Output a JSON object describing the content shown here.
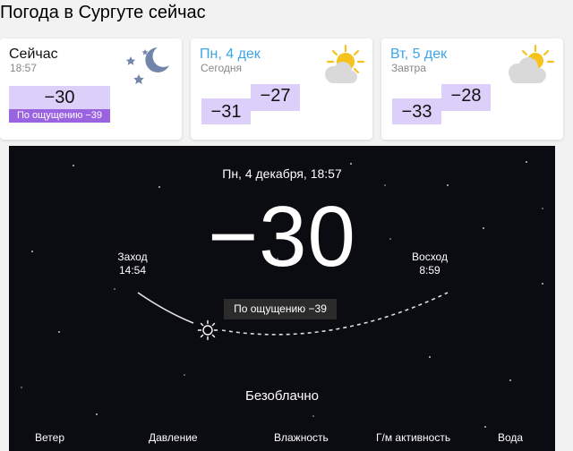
{
  "page_title": "Погода в Сургуте сейчас",
  "now_card": {
    "title": "Сейчас",
    "time": "18:57",
    "temp": "−30",
    "feels": "По ощущению −39",
    "icon": "moon-stars-icon"
  },
  "day_cards": [
    {
      "title": "Пн, 4 дек",
      "subtitle": "Сегодня",
      "min": "−31",
      "max": "−27",
      "icon": "sun-cloud-icon"
    },
    {
      "title": "Вт, 5 дек",
      "subtitle": "Завтра",
      "min": "−33",
      "max": "−28",
      "icon": "sun-cloud-icon"
    }
  ],
  "detail": {
    "date_time": "Пн, 4 декабря, 18:57",
    "temp": "−30",
    "feels": "По ощущению −39",
    "sunset_label": "Заход",
    "sunset_time": "14:54",
    "sunrise_label": "Восход",
    "sunrise_time": "8:59",
    "condition": "Безоблачно",
    "metrics": [
      "Ветер",
      "Давление",
      "Влажность",
      "Г/м активность",
      "Вода"
    ]
  },
  "colors": {
    "accent_purple": "#9a64e0",
    "temp_bg": "#dcd0fa",
    "day_blue": "#3da5e8",
    "panel_bg": "#0b0b12",
    "moon": "#7186a8",
    "sun": "#f6c21c"
  }
}
